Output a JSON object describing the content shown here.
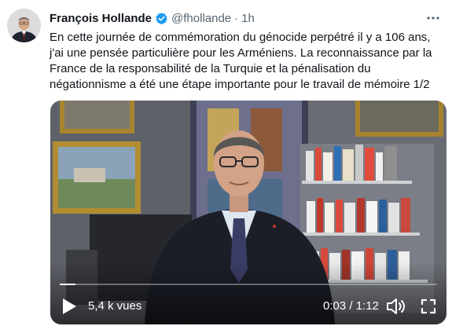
{
  "tweet": {
    "author_name": "François Hollande",
    "handle": "@fhollande",
    "separator": "·",
    "time": "1h",
    "text": "En cette journée de commémoration du génocide perpétré il y a 106 ans, j'ai une pensée particulière pour les Arméniens. La reconnaissance par la France de la responsabilité de la Turquie et la pénalisation du négationnisme a été une étape importante pour le travail de mémoire 1/2"
  },
  "video": {
    "views": "5,4 k vues",
    "timecode": "0:03 / 1:12",
    "progress": 0.042
  },
  "colors": {
    "verified": "#1d9bf0",
    "text": "#0f1419",
    "secondary": "#536471"
  },
  "icons": {
    "verified": "verified-badge-icon",
    "more": "more-options-icon",
    "play": "play-icon",
    "volume": "volume-icon",
    "fullscreen": "fullscreen-icon"
  }
}
